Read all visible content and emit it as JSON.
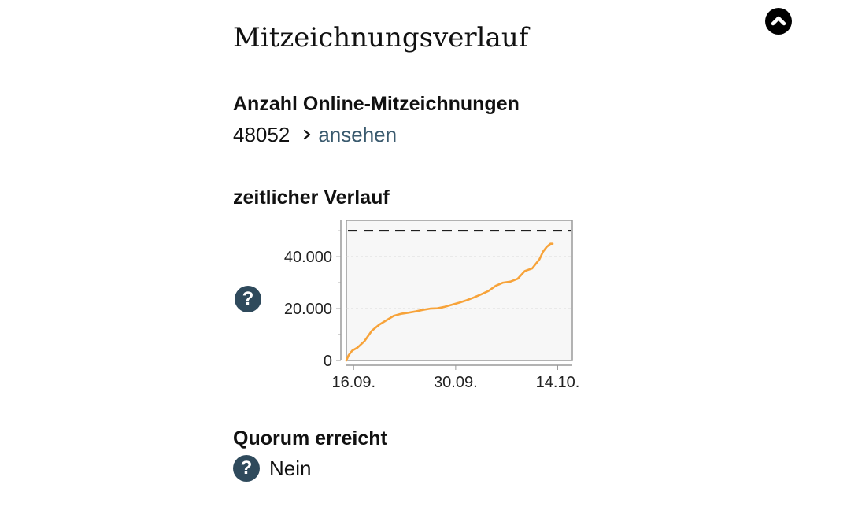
{
  "header": {
    "title": "Mitzeichnungsverlauf",
    "scroll_top_icon": "chevron-up-circle-icon"
  },
  "online_signatures": {
    "heading": "Anzahl Online-Mitzeichnungen",
    "count": "48052",
    "view_link": "ansehen"
  },
  "timeline": {
    "heading": "zeitlicher Verlauf",
    "help_icon": "question-icon"
  },
  "quorum": {
    "heading": "Quorum erreicht",
    "value": "Nein",
    "help_icon": "question-icon"
  },
  "colors": {
    "accent_link": "#3a5a6e",
    "help_icon_bg": "#2f4a5c",
    "line_series": "#f7a33a",
    "quorum_line": "#000000"
  },
  "chart_data": {
    "type": "line",
    "x_tick_labels": [
      "16.09.",
      "30.09.",
      "14.10."
    ],
    "y_tick_labels": [
      "0",
      "20.000",
      "40.000"
    ],
    "y_ticks": [
      0,
      20000,
      40000
    ],
    "x_range_days": [
      0,
      31
    ],
    "x_tick_days": [
      1,
      15,
      29
    ],
    "ylim": [
      0,
      54000
    ],
    "grid": true,
    "quorum_value": 50000,
    "series": [
      {
        "x": [
          0,
          0.3,
          0.8,
          1.5,
          2.5,
          3.5,
          4.5,
          5.5,
          6.5,
          7.5,
          8.5,
          9.5,
          10.5,
          11.5,
          12.5,
          13.5,
          14.5,
          15.5,
          16.5,
          17.5,
          18.5,
          19.5,
          20.5,
          21.5,
          22.5,
          23.5,
          24.5,
          25.5,
          26.5,
          27,
          27.5,
          28,
          28.3
        ],
        "y": [
          0,
          2000,
          3800,
          4900,
          7500,
          11500,
          13800,
          15500,
          17200,
          18000,
          18400,
          18900,
          19500,
          20000,
          20100,
          20700,
          21500,
          22300,
          23200,
          24300,
          25500,
          26800,
          28800,
          30000,
          30400,
          31500,
          34500,
          35500,
          39000,
          42000,
          43800,
          45000,
          45000
        ]
      }
    ]
  }
}
